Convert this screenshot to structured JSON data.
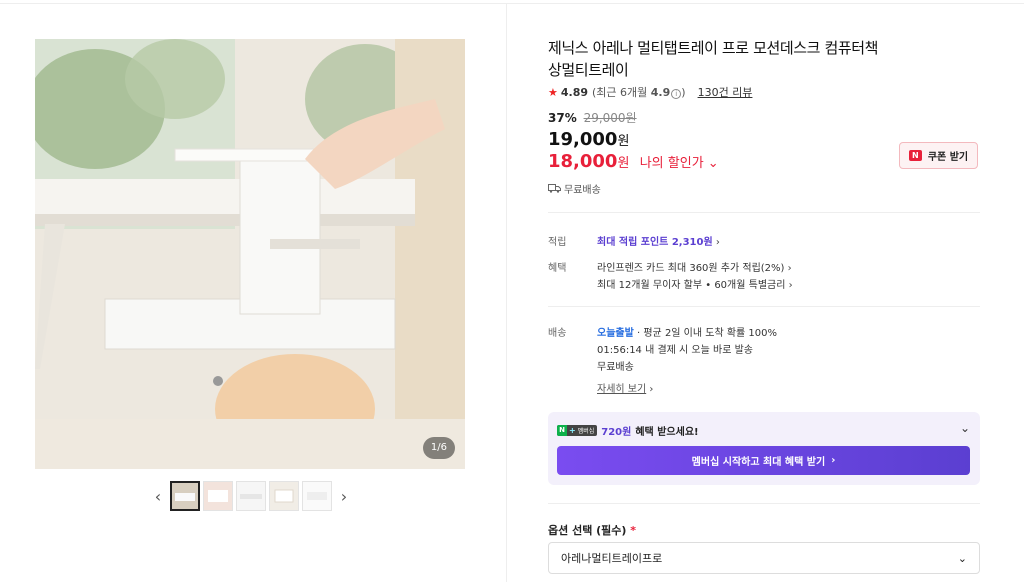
{
  "product": {
    "title": "제닉스 아레나 멀티탭트레이 프로 모션데스크 컴퓨터책상멀티트레이",
    "rating": {
      "score": "4.89",
      "recent_prefix": "(최근 6개월 ",
      "recent_score": "4.9",
      "recent_suffix": ")",
      "review_count": "130건 리뷰"
    },
    "price": {
      "discount_rate": "37%",
      "original": "29,000원",
      "sale": "19,000",
      "sale_unit": "원",
      "my_price": "18,000",
      "my_price_unit": "원",
      "my_price_label": "나의 할인가"
    },
    "coupon_button": "쿠폰 받기",
    "free_shipping": "무료배송"
  },
  "gallery": {
    "counter": "1/6",
    "thumb_count": 5,
    "prev_icon": "‹",
    "next_icon": "›"
  },
  "benefits": {
    "point_label": "적립",
    "point_value": "최대 적립 포인트 2,310원",
    "benefit_label": "혜택",
    "benefit_line1": "라인프렌즈 카드 최대 360원 추가 적립(2%)",
    "benefit_line2": "최대 12개월 무이자 할부 • 60개월 특별금리"
  },
  "delivery": {
    "label": "배송",
    "today_badge": "오늘출발",
    "avg_text": "평균 2일 이내 도착 확률 100%",
    "cutoff": "01:56:14  내 결제 시 오늘 바로 발송",
    "free": "무료배송",
    "detail_link": "자세히 보기"
  },
  "membership": {
    "badge_text": "멤버십",
    "amount": "720원",
    "text": "혜택 받으세요!",
    "button": "멤버십 시작하고 최대 혜택 받기"
  },
  "option": {
    "label": "옵션 선택 (필수)",
    "required_mark": "*",
    "selected": "아레나멀티트레이프로"
  },
  "colors": {
    "accent_red": "#e8203a",
    "accent_purple": "#5b3fd1",
    "today_blue": "#2a6fe0"
  }
}
